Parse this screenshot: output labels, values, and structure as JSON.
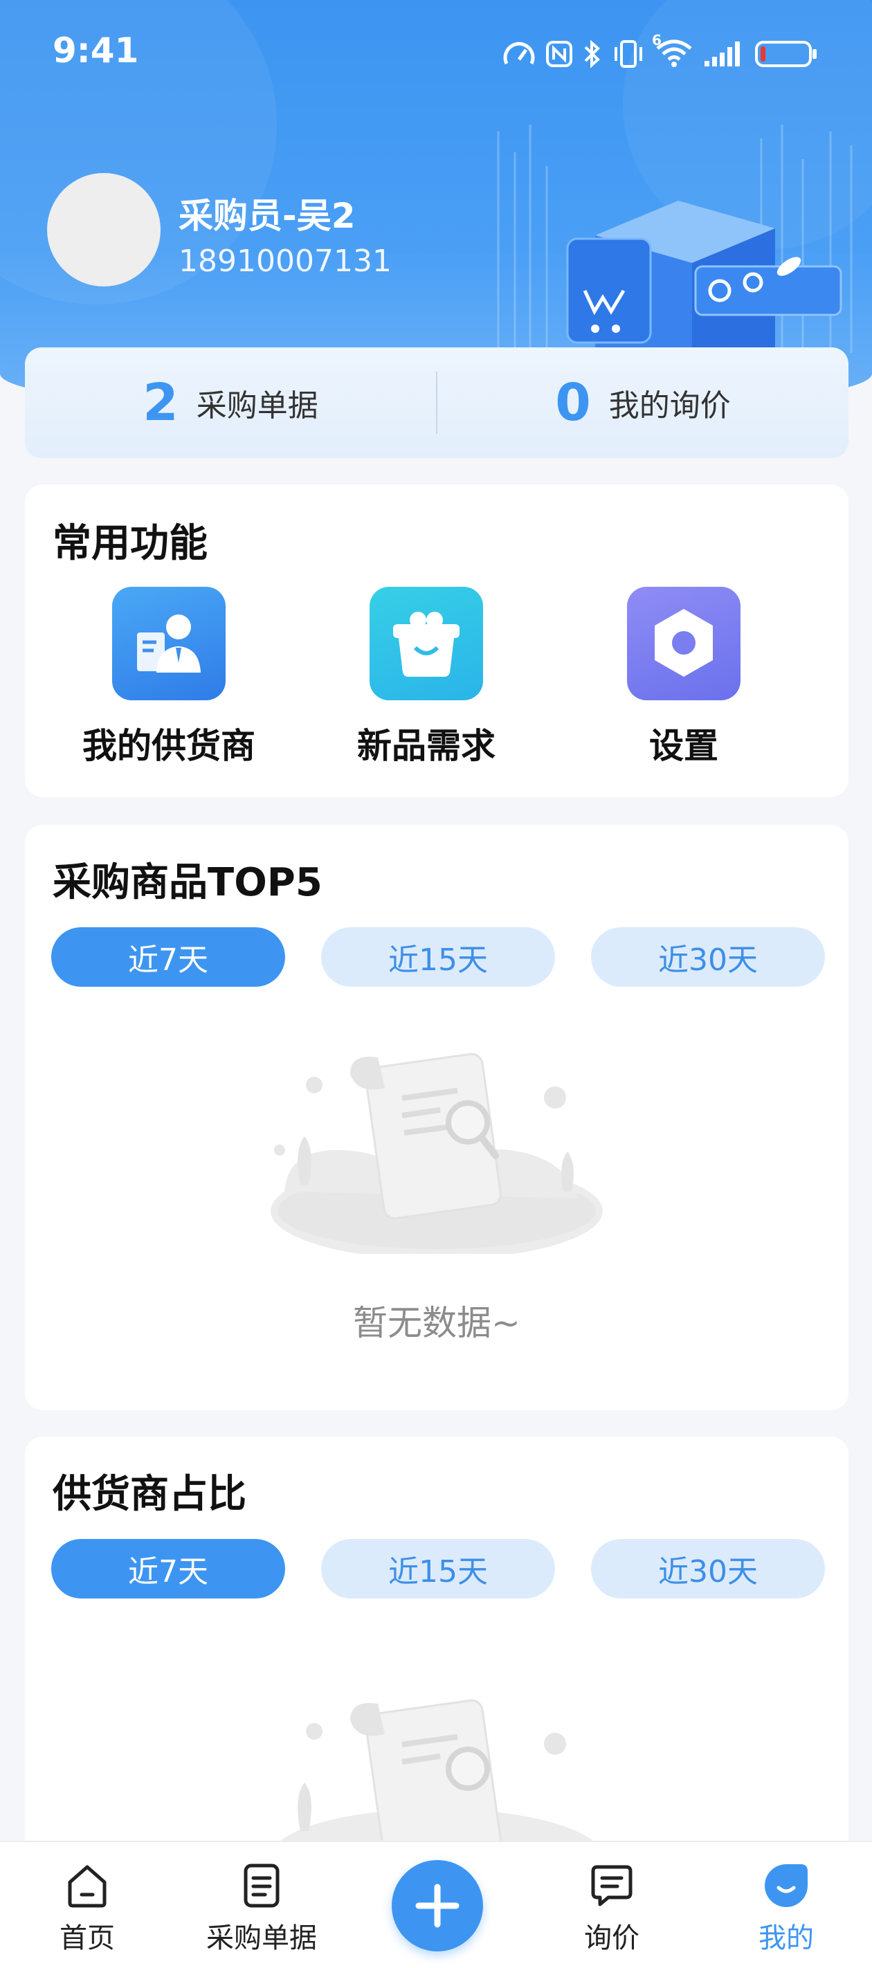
{
  "status_bar": {
    "time": "9:41",
    "icons": [
      "speedometer-icon",
      "nfc-icon",
      "bluetooth-icon",
      "vibrate-icon",
      "wifi-icon",
      "signal-icon",
      "battery-icon"
    ],
    "wifi_badge": "6",
    "battery_color": "#e53935"
  },
  "profile": {
    "name": "采购员-吴2",
    "phone": "18910007131"
  },
  "stats": [
    {
      "value": "2",
      "label": "采购单据"
    },
    {
      "value": "0",
      "label": "我的询价"
    }
  ],
  "common_functions": {
    "title": "常用功能",
    "items": [
      {
        "label": "我的供货商",
        "icon": "supplier-icon"
      },
      {
        "label": "新品需求",
        "icon": "new-product-basket-icon"
      },
      {
        "label": "设置",
        "icon": "settings-nut-icon"
      }
    ]
  },
  "top5": {
    "title": "采购商品TOP5",
    "tabs": [
      "近7天",
      "近15天",
      "近30天"
    ],
    "active_tab": 0,
    "empty_text": "暂无数据~"
  },
  "supplier_ratio": {
    "title": "供货商占比",
    "tabs": [
      "近7天",
      "近15天",
      "近30天"
    ],
    "active_tab": 0
  },
  "bottom_nav": {
    "items": [
      {
        "label": "首页",
        "icon": "home-icon"
      },
      {
        "label": "采购单据",
        "icon": "document-icon"
      },
      {
        "label": "询价",
        "icon": "message-icon"
      },
      {
        "label": "我的",
        "icon": "profile-smile-icon"
      }
    ],
    "active": 3,
    "fab_icon": "plus-icon"
  },
  "colors": {
    "primary": "#3d95f1",
    "tab_inactive_bg": "#dcebfc",
    "empty_text": "#8c8c8c"
  }
}
